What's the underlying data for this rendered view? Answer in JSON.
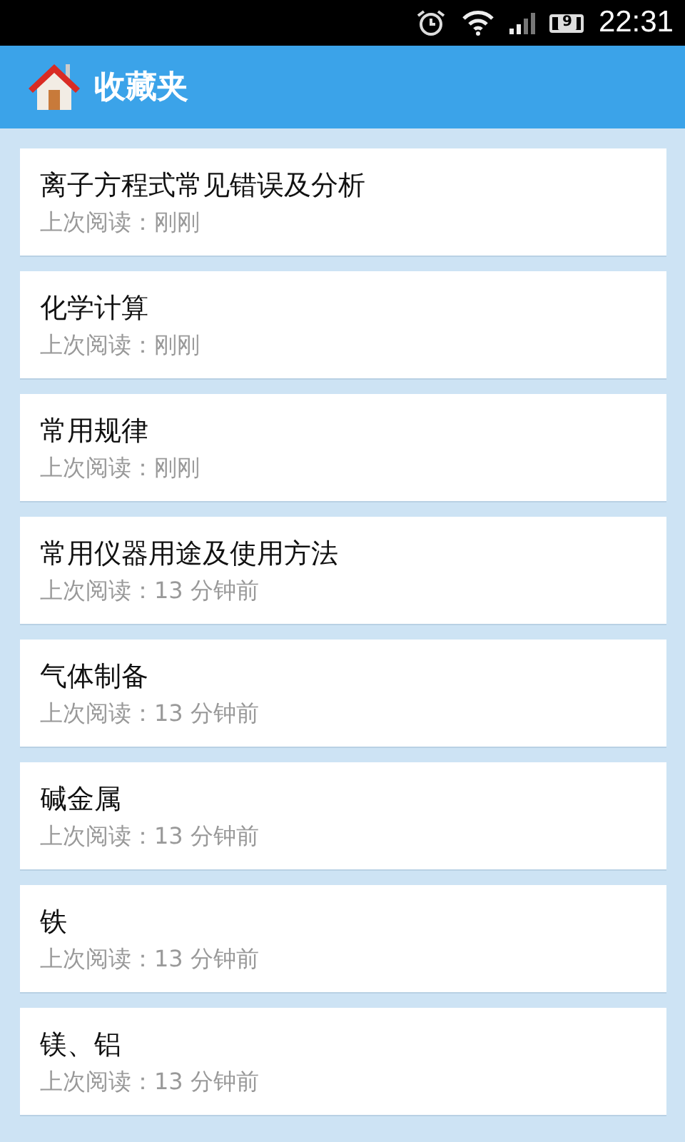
{
  "status_bar": {
    "battery": "9",
    "time": "22:31"
  },
  "header": {
    "title": "收藏夹"
  },
  "items": [
    {
      "title": "离子方程式常见错误及分析",
      "subtitle": "上次阅读：刚刚"
    },
    {
      "title": "化学计算",
      "subtitle": "上次阅读：刚刚"
    },
    {
      "title": "常用规律",
      "subtitle": "上次阅读：刚刚"
    },
    {
      "title": "常用仪器用途及使用方法",
      "subtitle": "上次阅读：13 分钟前"
    },
    {
      "title": "气体制备",
      "subtitle": "上次阅读：13 分钟前"
    },
    {
      "title": "碱金属",
      "subtitle": "上次阅读：13 分钟前"
    },
    {
      "title": "铁",
      "subtitle": "上次阅读：13 分钟前"
    },
    {
      "title": "镁、铝",
      "subtitle": "上次阅读：13 分钟前"
    }
  ]
}
